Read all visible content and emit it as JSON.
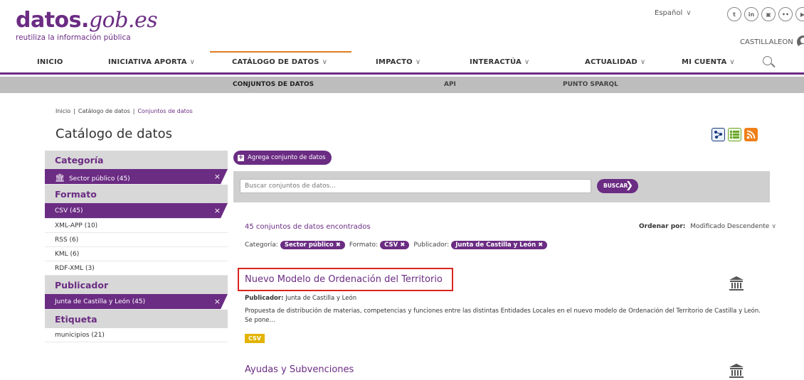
{
  "header": {
    "logo_main": "datos.",
    "logo_gob": "gob.es",
    "logo_sub": "reutiliza la información pública",
    "language": "Español",
    "social_icons": [
      "twitter-icon",
      "linkedin-icon",
      "youtube-icon",
      "flickr-icon",
      "youtube-play-icon"
    ],
    "user_name": "CASTILLALEON"
  },
  "mainnav": {
    "items": [
      {
        "label": "INICIO"
      },
      {
        "label": "INICIATIVA APORTA"
      },
      {
        "label": "CATÁLOGO DE DATOS"
      },
      {
        "label": "IMPACTO"
      },
      {
        "label": "INTERACTÚA"
      },
      {
        "label": "ACTUALIDAD"
      },
      {
        "label": "MI CUENTA"
      }
    ]
  },
  "subnav": {
    "items": [
      {
        "label": "CONJUNTOS DE DATOS"
      },
      {
        "label": "API"
      },
      {
        "label": "PUNTO SPARQL"
      }
    ]
  },
  "breadcrumb": {
    "items": [
      "Inicio",
      "Catálogo de datos",
      "Conjuntos de datos"
    ]
  },
  "page_title": "Catálogo de datos",
  "sidebar": {
    "categoria": {
      "title": "Categoría",
      "selected": "Sector público (45)"
    },
    "formato": {
      "title": "Formato",
      "selected": "CSV (45)",
      "items": [
        "XML-APP (10)",
        "RSS (6)",
        "KML (6)",
        "RDF-XML (3)"
      ]
    },
    "publicador": {
      "title": "Publicador",
      "selected": "Junta de Castilla y León (45)"
    },
    "etiqueta": {
      "title": "Etiqueta",
      "items": [
        "municipios (21)"
      ]
    }
  },
  "content": {
    "add_button": "Agrega conjunto de datos",
    "search_placeholder": "Buscar conjuntos de datos...",
    "search_button": "BUSCAR",
    "results_count": "45 conjuntos de datos encontrados",
    "sort_label": "Ordenar por:",
    "sort_value": "Modificado Descendente",
    "filters": {
      "categoria_label": "Categoría:",
      "categoria_chip": "Sector público",
      "formato_label": "Formato:",
      "formato_chip": "CSV",
      "publicador_label": "Publicador:",
      "publicador_chip": "Junta de Castilla y León"
    },
    "results": [
      {
        "title": "Nuevo Modelo de Ordenación del Territorio",
        "publisher_label": "Publicador:",
        "publisher": "Junta de Castilla y León",
        "description": "Propuesta de distribución de materias, competencias y funciones entre las distintas Entidades Locales en el nuevo modelo de Ordenación del Territorio de Castilla y León. Se pone...",
        "format": "CSV"
      },
      {
        "title": "Ayudas y Subvenciones"
      }
    ]
  },
  "colors": {
    "brand_purple": "#6b2c83",
    "accent_orange": "#e07c20",
    "highlight_red": "#d9251c",
    "csv_tag": "#e2b300"
  }
}
